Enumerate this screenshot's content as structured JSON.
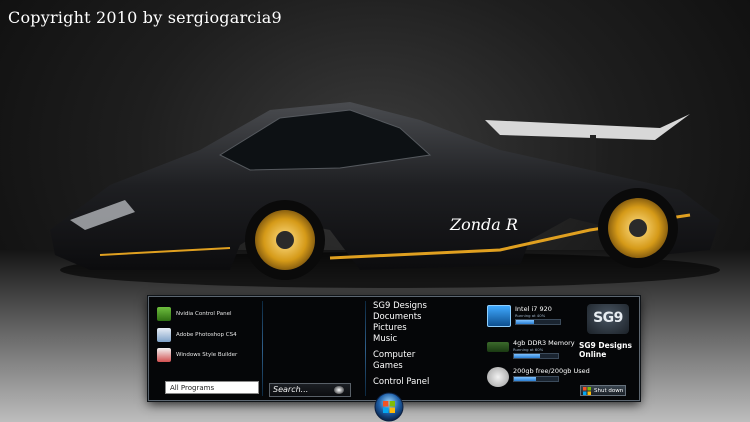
{
  "wallpaper": {
    "copyright": "Copyright 2010 by sergiogarcia9",
    "car_text": "Zonda R"
  },
  "start_menu": {
    "pinned_programs": [
      {
        "label": "Nvidia Control Panel",
        "icon": "nvidia-icon",
        "color": "#3f8f1f"
      },
      {
        "label": "Adobe Photoshop CS4",
        "icon": "photoshop-icon",
        "color": "#1f5fa8"
      },
      {
        "label": "Windows Style Builder",
        "icon": "style-builder-icon",
        "color": "#c23b3b"
      }
    ],
    "all_programs": "All Programs",
    "search_placeholder": "Search...",
    "places": [
      "SG9 Designs",
      "Documents",
      "Pictures",
      "Music",
      "Computer",
      "Games",
      "Control Panel"
    ],
    "system": {
      "cpu": {
        "title": "Intel i7 920",
        "sub": "Running at 40%",
        "level": 0.4
      },
      "memory": {
        "title": "4gb DDR3 Memory",
        "sub": "Running at 60%",
        "level": 0.6
      },
      "disk": {
        "title": "200gb free/200gb Used",
        "level": 0.5
      }
    },
    "brand_logo": "SG9",
    "brand_text": "SG9 Designs Online",
    "shutdown": "Shut down"
  },
  "colors": {
    "accent": "#2a7fd4",
    "car_trim": "#e0a020",
    "panel_bg": "#050608"
  }
}
